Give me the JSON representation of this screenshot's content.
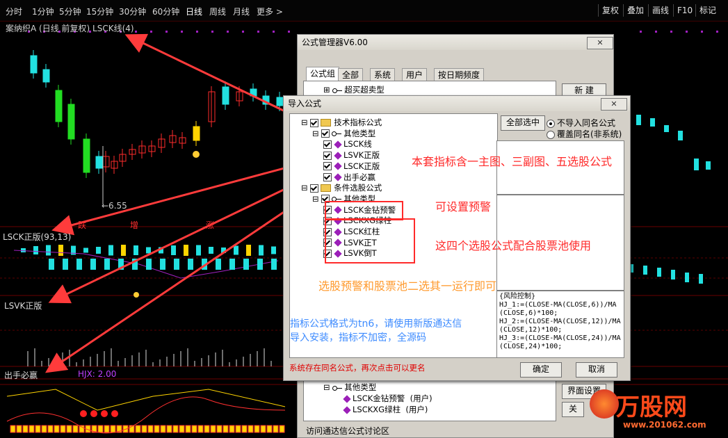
{
  "periods": [
    "分时",
    "1分钟",
    "5分钟",
    "15分钟",
    "30分钟",
    "60分钟",
    "日线",
    "周线",
    "月线",
    "更多 >"
  ],
  "active_period": "日线",
  "toolbar_right": [
    "复权",
    "叠加",
    "画线",
    "F10",
    "标记"
  ],
  "chart_title": "案纳织A (日线 前复权) LSCK线(4)",
  "price_low_label": "←6.55",
  "panel_labels": {
    "p2": "LSCK正版(93,13)",
    "p3": "LSVK正版",
    "p4": "出手必赢",
    "hjx": "HJX: 2.00"
  },
  "signal_words": [
    "跌",
    "增",
    "涨"
  ],
  "mgr": {
    "title": "公式管理器V6.00",
    "tabs": [
      "公式组",
      "全部",
      "系统",
      "用户",
      "按日期频度"
    ],
    "tree_top": "超买超卖型",
    "new_btn": "新 建",
    "bottom_tree": [
      {
        "label": "其他类型",
        "user": ""
      },
      {
        "label": "LSCK金钻预警",
        "user": "(用户)"
      },
      {
        "label": "LSCKXG绿柱",
        "user": "(用户)"
      }
    ],
    "ui_btn": "界面设置",
    "close_btn": "关",
    "footer": "访问通达信公式讨论区"
  },
  "imp": {
    "title": "导入公式",
    "close": "✕",
    "tree": [
      {
        "kind": "folder",
        "label": "技术指标公式",
        "level": 0
      },
      {
        "kind": "group",
        "label": "其他类型",
        "level": 1
      },
      {
        "kind": "item",
        "label": "LSCK线",
        "level": 2
      },
      {
        "kind": "item",
        "label": "LSVK正版",
        "level": 2
      },
      {
        "kind": "item",
        "label": "LSCK正版",
        "level": 2
      },
      {
        "kind": "item",
        "label": "出手必赢",
        "level": 2
      },
      {
        "kind": "folder",
        "label": "条件选股公式",
        "level": 0
      },
      {
        "kind": "group",
        "label": "其他类型",
        "level": 1
      },
      {
        "kind": "item",
        "label": "LSCK金钻预警",
        "level": 2
      },
      {
        "kind": "item",
        "label": "LSCKXG绿柱",
        "level": 2
      },
      {
        "kind": "item",
        "label": "LSCK红柱",
        "level": 2
      },
      {
        "kind": "item",
        "label": "LSVK正T",
        "level": 2
      },
      {
        "kind": "item",
        "label": "LSVK倒T",
        "level": 2
      }
    ],
    "select_all": "全部选中",
    "opt_no_import": "不导入同名公式",
    "opt_overwrite": "覆盖同名(非系统)",
    "code": "{风险控制}\nHJ_1:=(CLOSE-MA(CLOSE,6))/MA\n(CLOSE,6)*100;\nHJ_2:=(CLOSE-MA(CLOSE,12))/MA\n(CLOSE,12)*100;\nHJ_3:=(CLOSE-MA(CLOSE,24))/MA\n(CLOSE,24)*100;",
    "status": "系统存在同名公式，再次点击可以更名",
    "ok": "确定",
    "cancel": "取消"
  },
  "annotations": {
    "a1": "本套指标含一主图、三副图、五选股公式",
    "a2": "可设置预警",
    "a3": "这四个选股公式配合股票池使用",
    "a4": "选股预警和股票池二选其一运行即可",
    "a5_line1": "指标公式格式为tn6，请使用新版通达信",
    "a5_line2": "导入安装，指标不加密，全源码"
  },
  "watermark": {
    "brand": "万股网",
    "url": "www.201062.com"
  },
  "colors": {
    "up": "#ff2b2b",
    "down": "#22e0e0",
    "green": "#22dd22",
    "annotation": "#ff2a2a",
    "annotation_orange": "#ff9a2e",
    "annotation_blue": "#3d8bff",
    "arrow": "#ff3b3b"
  }
}
